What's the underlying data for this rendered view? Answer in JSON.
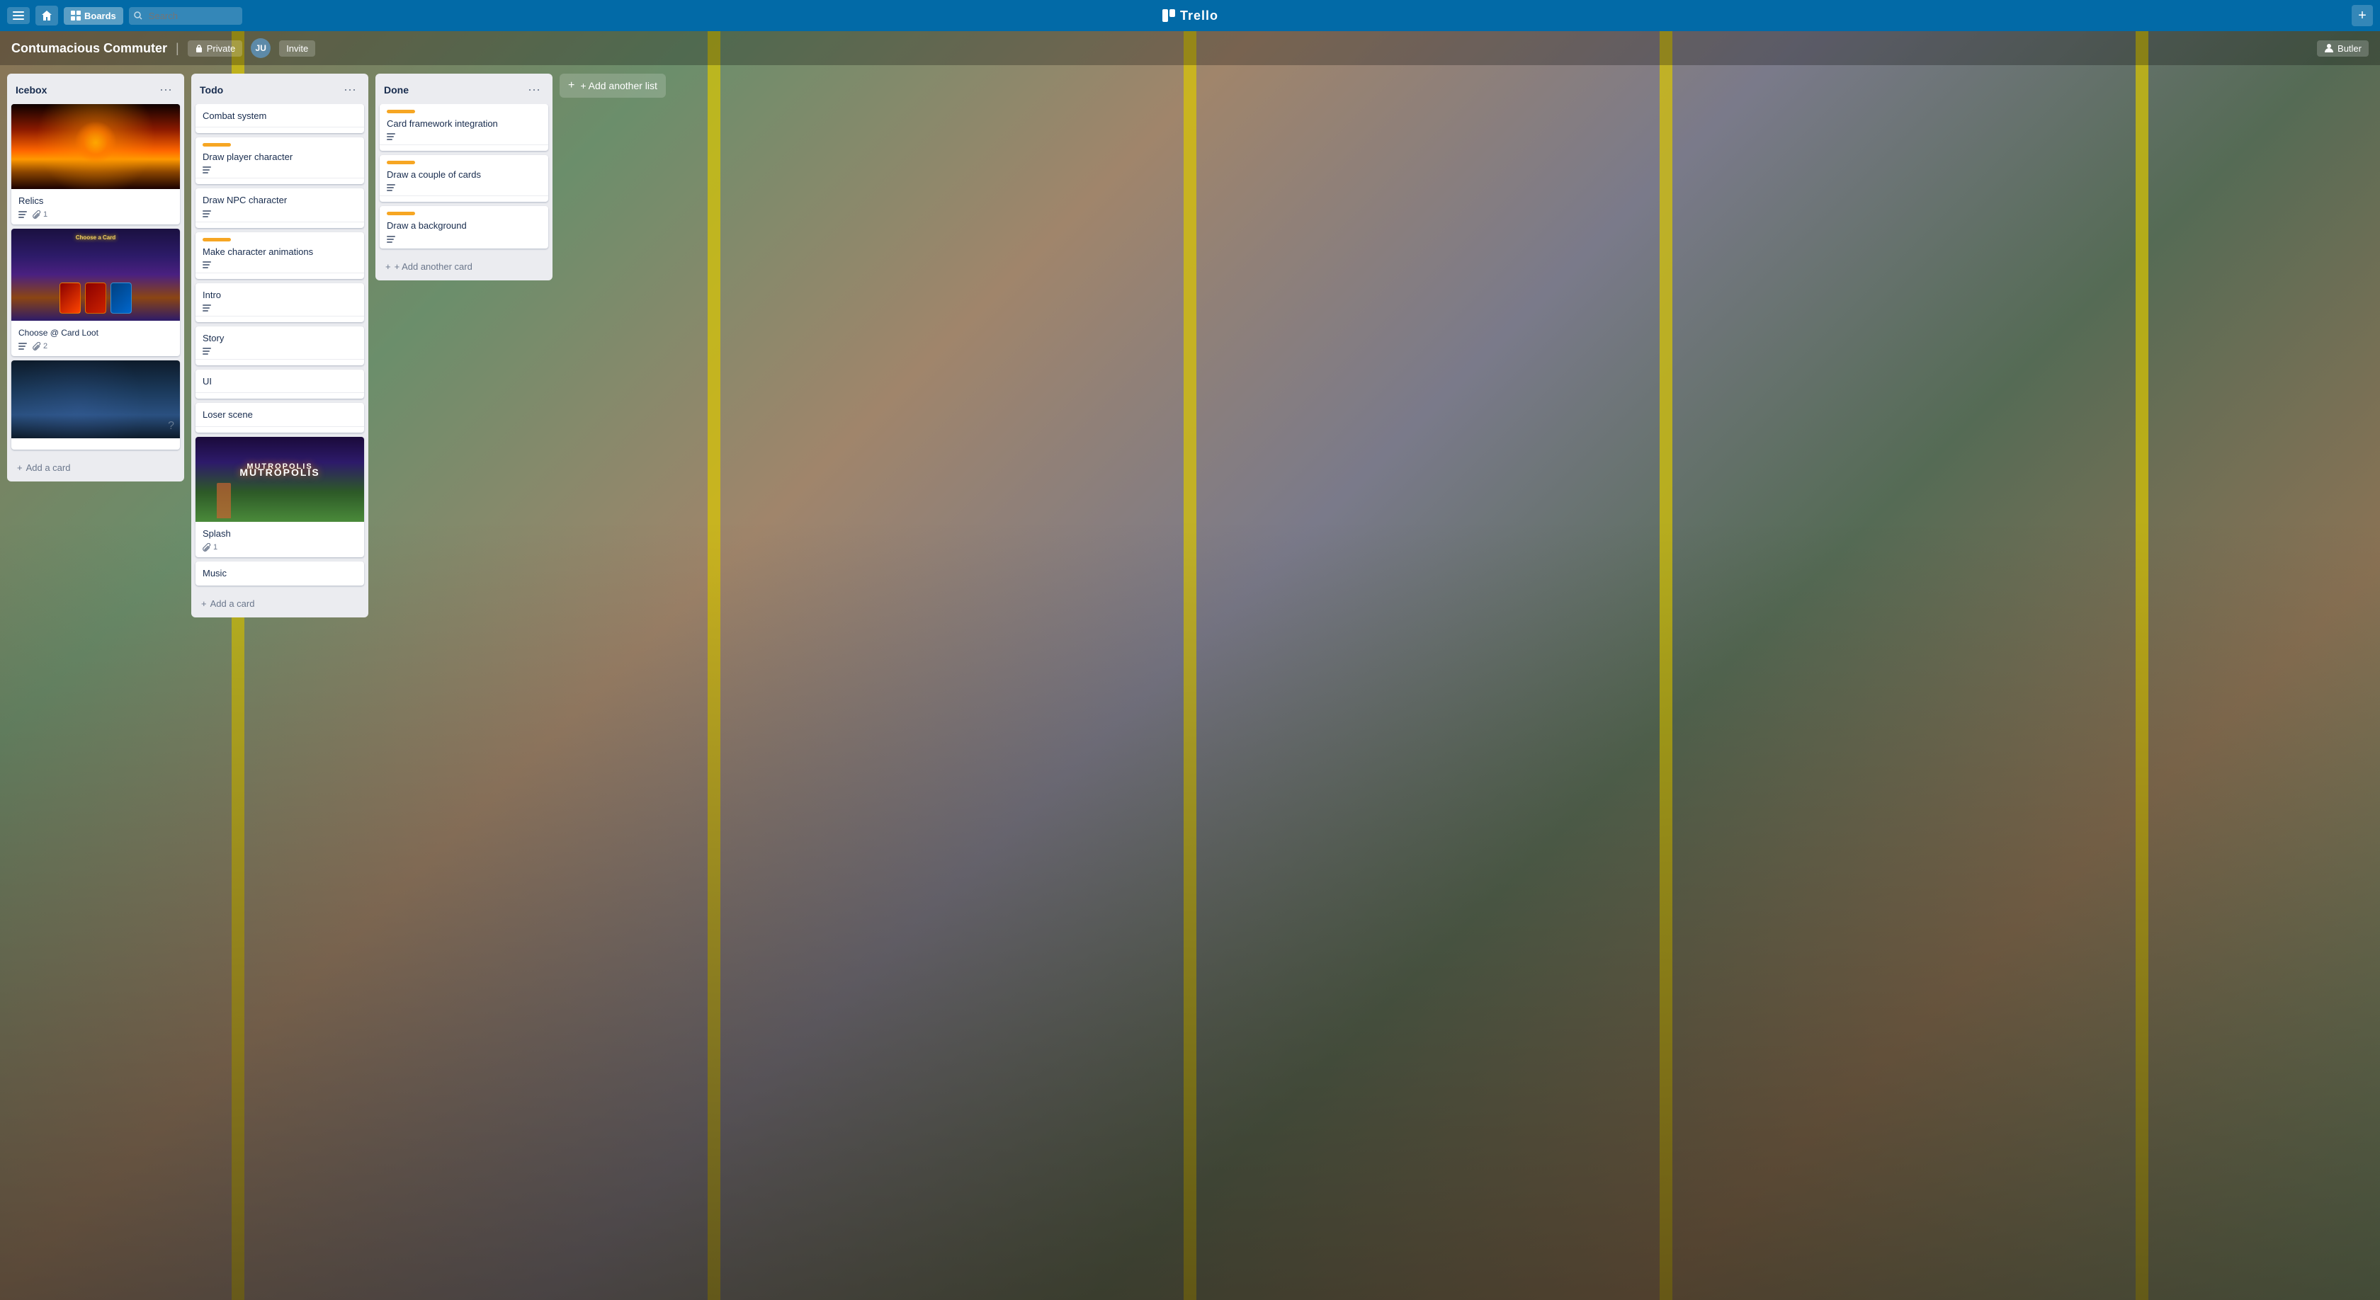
{
  "app": {
    "name": "Trello",
    "logo": "📋"
  },
  "topNav": {
    "menuLabel": "☰",
    "homeLabel": "🏠",
    "boardsLabel": "Boards",
    "searchPlaceholder": "Search",
    "addLabel": "+"
  },
  "boardHeader": {
    "title": "Contumacious Commuter",
    "visibilityIcon": "🔒",
    "visibilityLabel": "Private",
    "inviteLabel": "Invite",
    "avatarInitials": "JU",
    "butlerLabel": "Butler",
    "butlerIcon": "🤖"
  },
  "addAnotherList": "Add another list",
  "lists": [
    {
      "id": "icebox",
      "title": "Icebox",
      "cards": [
        {
          "id": "relics",
          "title": "Relics",
          "hasImage": true,
          "imageType": "icebox-card1",
          "metaDescription": true,
          "metaAttachments": "1"
        },
        {
          "id": "choose-card-loot",
          "title": "Choose @ Card Loot",
          "hasImage": true,
          "imageType": "icebox-card2",
          "metaDescription": true,
          "metaAttachments": "2"
        },
        {
          "id": "map",
          "title": "",
          "hasImage": true,
          "imageType": "icebox-card3",
          "metaDescription": false,
          "metaAttachments": ""
        }
      ]
    },
    {
      "id": "todo",
      "title": "Todo",
      "cards": [
        {
          "id": "combat-system",
          "title": "Combat system",
          "hasLabel": false,
          "hasDescription": false
        },
        {
          "id": "draw-player-character",
          "title": "Draw player character",
          "hasLabel": true,
          "hasDescription": true
        },
        {
          "id": "draw-npc-character",
          "title": "Draw NPC character",
          "hasLabel": false,
          "hasDescription": true
        },
        {
          "id": "make-character-animations",
          "title": "Make character animations",
          "hasLabel": true,
          "hasDescription": true
        },
        {
          "id": "intro",
          "title": "Intro",
          "hasLabel": false,
          "hasDescription": true
        },
        {
          "id": "story",
          "title": "Story",
          "hasLabel": false,
          "hasDescription": true
        },
        {
          "id": "ui",
          "title": "UI",
          "hasLabel": false,
          "hasDescription": false
        },
        {
          "id": "loser-scene",
          "title": "Loser scene",
          "hasLabel": false,
          "hasDescription": false
        },
        {
          "id": "splash",
          "title": "Splash",
          "hasImage": true,
          "imageType": "splash-img",
          "hasLabel": false,
          "metaAttachments": "1"
        },
        {
          "id": "music",
          "title": "Music",
          "hasLabel": false,
          "hasDescription": false
        }
      ]
    },
    {
      "id": "done",
      "title": "Done",
      "cards": [
        {
          "id": "card-framework-integration",
          "title": "Card framework integration",
          "hasLabel": true,
          "hasDescription": true
        },
        {
          "id": "draw-couple-cards",
          "title": "Draw a couple of cards",
          "hasLabel": true,
          "hasDescription": true
        },
        {
          "id": "draw-background",
          "title": "Draw a background",
          "hasLabel": true,
          "hasDescription": true
        }
      ],
      "addCardLabel": "+ Add another card"
    }
  ],
  "addAnotherListLabel": "+ Add another list"
}
